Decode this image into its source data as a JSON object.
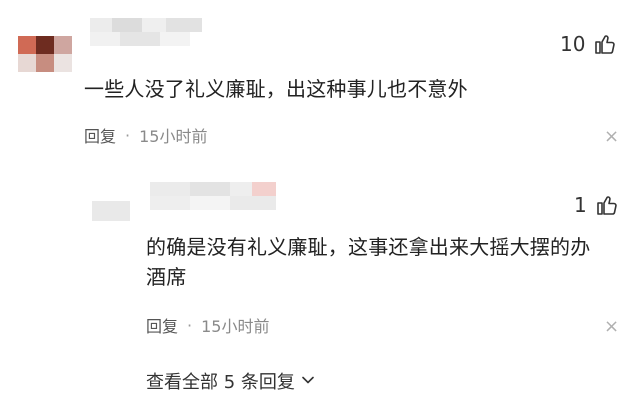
{
  "comments": [
    {
      "text": "一些人没了礼义廉耻，出这种事儿也不意外",
      "likes": "10",
      "reply_label": "回复",
      "separator": "·",
      "time": "15小时前",
      "close_glyph": "×"
    }
  ],
  "replies": [
    {
      "text_line1": "的确是没有礼义廉耻，这事还拿出来大摇大摆的办",
      "text_line2": "酒席",
      "likes": "1",
      "reply_label": "回复",
      "separator": "·",
      "time": "15小时前",
      "close_glyph": "×"
    }
  ],
  "view_all": {
    "label": "查看全部 5 条回复",
    "chevron": "⌄"
  },
  "colors": {
    "avatar_mosaic_1": [
      "#c94a3a",
      "#7a2e22",
      "#d9a49a",
      "#e6e6e6"
    ],
    "name_blur": "#e3e3e3",
    "text": "#222222",
    "muted": "#8a8a8a"
  }
}
